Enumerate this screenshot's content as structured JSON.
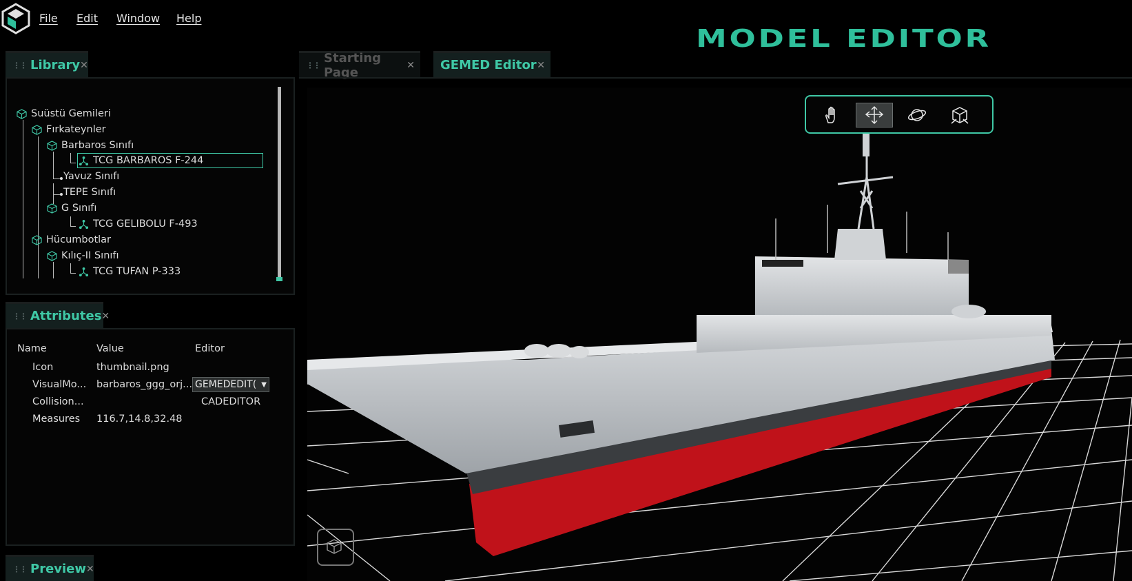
{
  "menu": {
    "file": "File",
    "edit": "Edit",
    "window": "Window",
    "help": "Help"
  },
  "app_title": "MODEL EDITOR",
  "library": {
    "tab_label": "Library",
    "tree": [
      {
        "label": "Suüstü Gemileri",
        "type": "group"
      },
      {
        "label": "Fırkateynler",
        "type": "group"
      },
      {
        "label": "Barbaros Sınıfı",
        "type": "group"
      },
      {
        "label": "TCG BARBAROS F-244",
        "type": "model",
        "selected": true
      },
      {
        "label": "Yavuz Sınıfı",
        "type": "leaf"
      },
      {
        "label": "TEPE Sınıfı",
        "type": "leaf"
      },
      {
        "label": "G Sınıfı",
        "type": "group"
      },
      {
        "label": "TCG GELIBOLU F-493",
        "type": "model"
      },
      {
        "label": "Hücumbotlar",
        "type": "group"
      },
      {
        "label": "Kılıç-II Sınıfı",
        "type": "group"
      },
      {
        "label": "TCG TUFAN P-333",
        "type": "model"
      }
    ]
  },
  "attributes": {
    "tab_label": "Attributes",
    "headers": {
      "name": "Name",
      "value": "Value",
      "editor": "Editor"
    },
    "rows": [
      {
        "name": "Icon",
        "value": "thumbnail.png",
        "editor": ""
      },
      {
        "name": "VisualMo...",
        "value": "barbaros_ggg_orj...",
        "editor": "GEMEDEDIT("
      },
      {
        "name": "Collision...",
        "value": "",
        "editor": "CADEDITOR"
      },
      {
        "name": "Measures",
        "value": "116.7,14.8,32.48",
        "editor": ""
      }
    ]
  },
  "preview": {
    "tab_label": "Preview"
  },
  "editor_tabs": [
    {
      "label": "Starting Page",
      "active": false
    },
    {
      "label": "GEMED Editor",
      "active": true
    }
  ],
  "viewport_tools": [
    "pan-hand-icon",
    "move-aircraft-icon",
    "orbit-icon",
    "box-view-icon"
  ],
  "colors": {
    "accent": "#3fc8a6",
    "hull_red": "#c0121a",
    "hull_gray": "#c9ccd0"
  }
}
